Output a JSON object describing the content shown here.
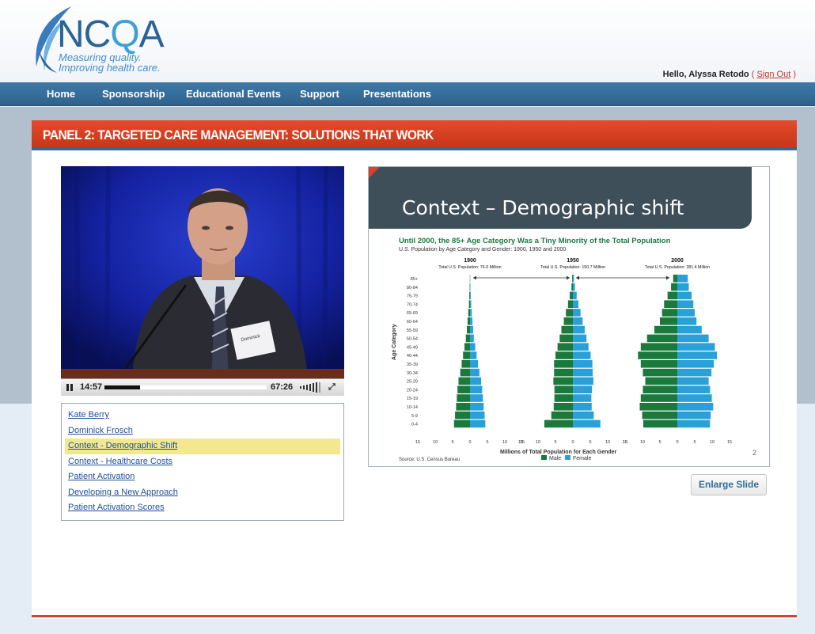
{
  "header": {
    "logo_text_left": "NC",
    "logo_text_q": "Q",
    "logo_text_right": "A",
    "logo_tagline_1": "Measuring quality.",
    "logo_tagline_2": "Improving health care.",
    "greeting_text": "Hello, Alyssa Retodo",
    "greeting_open": "(",
    "signout_label": "Sign Out",
    "greeting_close": ")"
  },
  "nav": {
    "items": [
      "Home",
      "Sponsorship",
      "Educational Events",
      "Support",
      "Presentations"
    ]
  },
  "panel": {
    "title": "PANEL 2: TARGETED CARE MANAGEMENT: SOLUTIONS THAT WORK"
  },
  "video": {
    "current_time": "14:57",
    "duration": "67:26",
    "progress_fraction": 0.22,
    "badge_name": "Dominick"
  },
  "chapters": {
    "items": [
      "Kate Berry",
      "Dominick Frosch",
      "Context - Demographic Shift",
      "Context - Healthcare Costs",
      "Patient Activation",
      "Developing a New Approach",
      "Patient Activation Scores"
    ],
    "active_index": 2
  },
  "slide": {
    "title": "Context – Demographic shift",
    "page_number": "2",
    "enlarge_label": "Enlarge Slide",
    "figure": {
      "heading": "Until 2000, the 85+ Age Category Was a Tiny Minority of the Total Population",
      "subheading": "U.S. Population by Age Category and Gender: 1900, 1950 and 2000",
      "source": "Source: U.S. Census Bureau",
      "xlabel": "Millions of Total Population for Each Gender",
      "ylabel": "Age Category",
      "legend": [
        "Male",
        "Female"
      ]
    }
  },
  "colors": {
    "male": "#1a7a3c",
    "female": "#2aa0d8",
    "brand_red": "#d8412a",
    "nav_blue": "#2f628c"
  },
  "chart_data": {
    "type": "bar",
    "title": "Until 2000, the 85+ Age Category Was a Tiny Minority of the Total Population",
    "subtitle": "U.S. Population by Age Category and Gender: 1900, 1950 and 2000",
    "xlabel": "Millions of Total Population for Each Gender",
    "ylabel": "Age Category",
    "legend": [
      "Male",
      "Female"
    ],
    "age_categories": [
      "85+",
      "80-84",
      "75-79",
      "70-74",
      "65-69",
      "60-64",
      "55-59",
      "50-54",
      "45-49",
      "40-44",
      "35-39",
      "30-34",
      "25-29",
      "20-24",
      "15-19",
      "10-14",
      "5-9",
      "0-4"
    ],
    "x_ticks": [
      "15",
      "10",
      "5",
      "0",
      "5",
      "10",
      "15"
    ],
    "xlim": [
      -15,
      15
    ],
    "panels": [
      {
        "year": "1900",
        "label": "Total U.S. Population: 76.0 Million",
        "male": [
          0.05,
          0.1,
          0.2,
          0.3,
          0.5,
          0.7,
          0.9,
          1.2,
          1.6,
          2.0,
          2.4,
          2.8,
          3.3,
          3.6,
          3.8,
          4.0,
          4.3,
          4.6
        ],
        "female": [
          0.07,
          0.12,
          0.22,
          0.35,
          0.5,
          0.7,
          0.9,
          1.1,
          1.5,
          1.9,
          2.3,
          2.7,
          3.2,
          3.5,
          3.7,
          3.9,
          4.2,
          4.4
        ]
      },
      {
        "year": "1950",
        "label": "Total U.S. Population: 150.7 Million",
        "male": [
          0.2,
          0.4,
          0.9,
          1.4,
          2.0,
          2.6,
          3.3,
          3.8,
          4.4,
          5.0,
          5.4,
          5.4,
          5.6,
          5.3,
          5.3,
          5.5,
          6.2,
          8.2
        ],
        "female": [
          0.3,
          0.6,
          1.1,
          1.6,
          2.2,
          2.8,
          3.4,
          3.9,
          4.5,
          5.1,
          5.6,
          5.7,
          5.9,
          5.5,
          5.3,
          5.4,
          6.0,
          7.9
        ]
      },
      {
        "year": "2000",
        "label": "Total U.S. Population: 281.4 Million",
        "male": [
          1.2,
          1.8,
          2.8,
          3.8,
          4.4,
          5.0,
          6.6,
          8.7,
          10.5,
          11.3,
          10.5,
          9.9,
          9.2,
          9.9,
          10.5,
          10.8,
          10.1,
          9.8
        ],
        "female": [
          3.0,
          3.3,
          4.1,
          4.6,
          5.0,
          5.5,
          7.0,
          9.0,
          10.8,
          11.4,
          10.5,
          9.8,
          9.0,
          9.4,
          9.9,
          10.3,
          9.6,
          9.4
        ]
      }
    ]
  }
}
